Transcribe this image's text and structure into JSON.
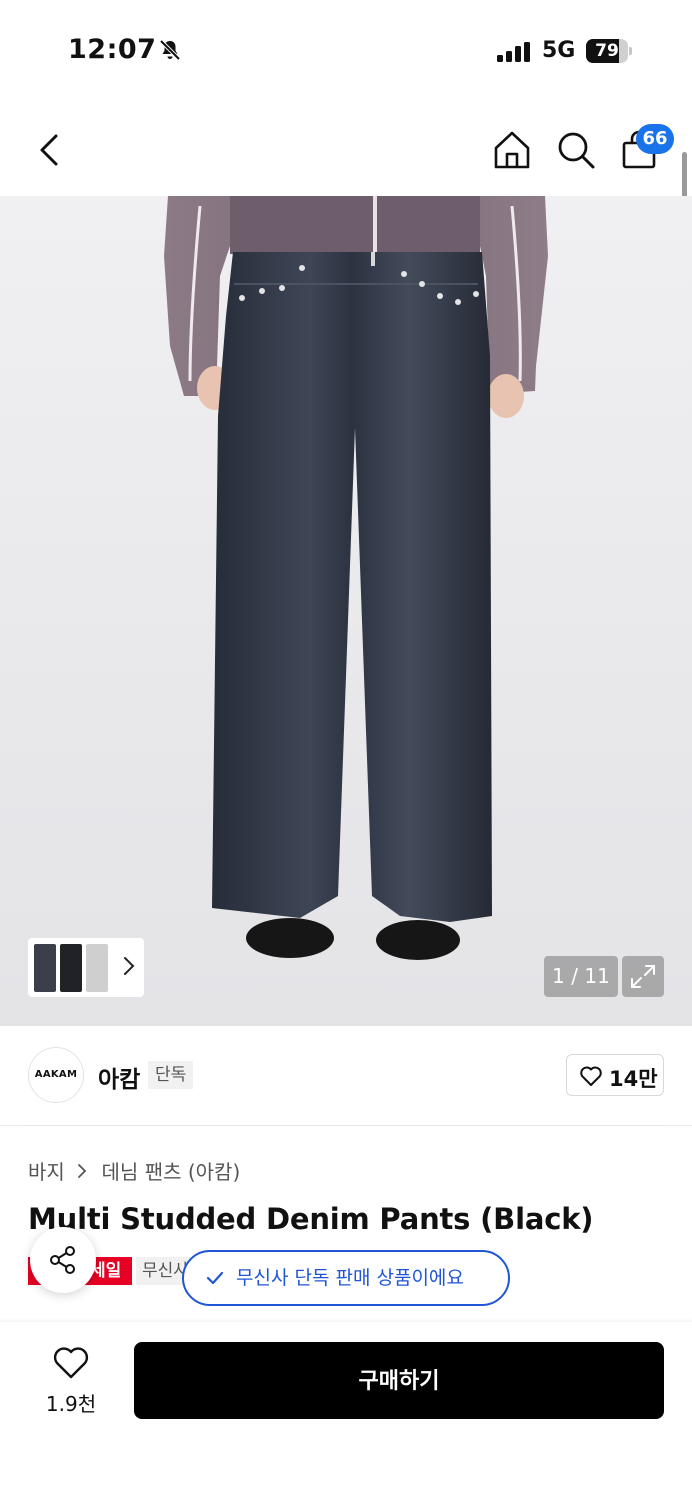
{
  "status_bar": {
    "time": "12:07",
    "network": "5G",
    "battery": "79",
    "battery_level": 0.79
  },
  "header": {
    "cart_count": "66"
  },
  "gallery": {
    "counter": "1 / 11"
  },
  "brand": {
    "logo_text": "AAKAM",
    "name": "아캄",
    "tag": "단독",
    "like_count": "14만"
  },
  "product": {
    "breadcrumb": [
      "바지",
      "데님 팬츠 (아캄)"
    ],
    "title": "Multi Studded Denim Pants (Black)",
    "sale_tag": "세일",
    "exclusive_tag": "무신사"
  },
  "toast": {
    "text": "무신사 단독 판매 상품이에요"
  },
  "bottom": {
    "wish_count": "1.9천",
    "buy_label": "구매하기"
  },
  "colors": {
    "accent": "#1f55d6",
    "sale": "#e60023",
    "badge": "#1a73e8",
    "denim": "#2f3644"
  }
}
